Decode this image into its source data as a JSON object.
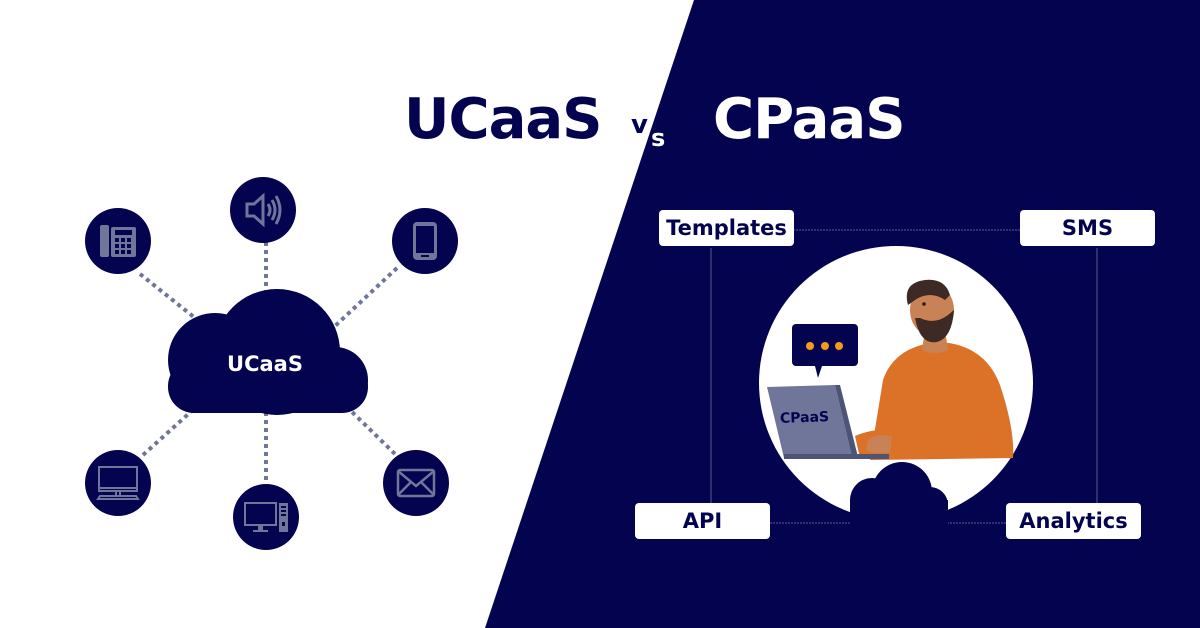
{
  "header": {
    "left_title": "UCaaS",
    "vs_v": "v",
    "vs_s": "s",
    "right_title": "CPaaS"
  },
  "colors": {
    "navy": "#03034f",
    "icon_gray": "#6f7699",
    "connector_gray": "#6f7699",
    "white": "#ffffff",
    "orange": "#dc7228",
    "accent_dot": "#f59a1b"
  },
  "ucaas": {
    "hub_label": "UCaaS",
    "nodes": [
      {
        "icon": "desk-phone-icon"
      },
      {
        "icon": "speaker-icon"
      },
      {
        "icon": "smartphone-icon"
      },
      {
        "icon": "monitor-icon"
      },
      {
        "icon": "desktop-computer-icon"
      },
      {
        "icon": "envelope-icon"
      }
    ]
  },
  "cpaas": {
    "boxes": {
      "top_left": "Templates",
      "top_right": "SMS",
      "bottom_left": "API",
      "bottom_right": "Analytics"
    },
    "laptop_label": "CPaaS",
    "speech_bubble_icon": "typing-dots-icon"
  }
}
